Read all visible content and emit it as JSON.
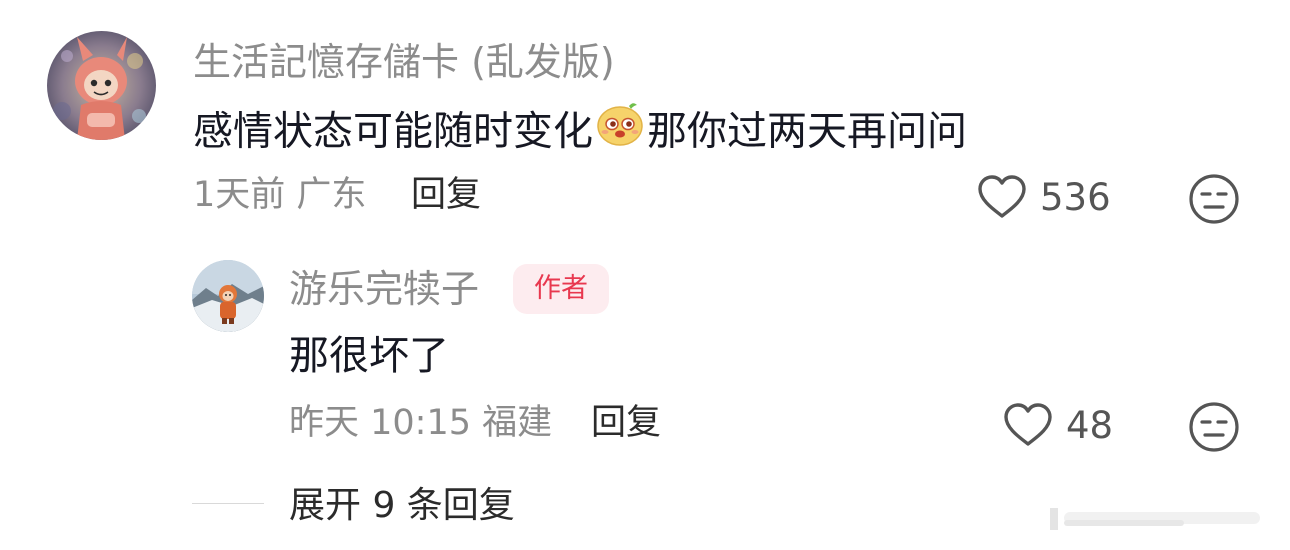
{
  "colors": {
    "name_gray": "#8c8c8c",
    "text_dark": "#161823",
    "author_badge_bg": "#fdecef",
    "author_badge_fg": "#e8384f"
  },
  "comment": {
    "username": "生活記憶存儲卡 (乱发版)",
    "text_part1": "感情状态可能随时变化",
    "emoji": "smirk-face-emoji",
    "text_part2": "那你过两天再问问",
    "meta": "1天前 广东",
    "reply_label": "回复",
    "likes": "536",
    "avatar": "pink-bunny-figure-avatar"
  },
  "reply": {
    "username": "游乐完犊子",
    "badge": "作者",
    "text": "那很坏了",
    "meta": "昨天 10:15 福建",
    "reply_label": "回复",
    "likes": "48",
    "avatar": "figure-on-mountain-avatar"
  },
  "expand": {
    "label": "展开 9 条回复"
  }
}
